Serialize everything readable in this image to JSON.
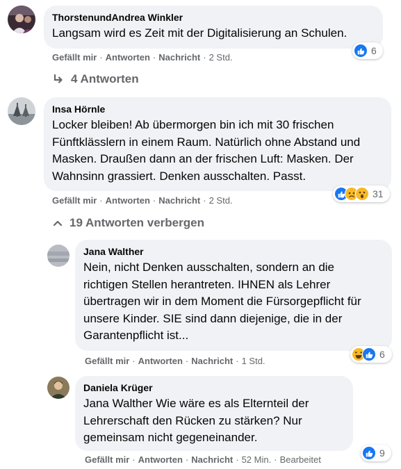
{
  "common": {
    "like": "Gefällt mir",
    "reply": "Antworten",
    "message": "Nachricht",
    "dot": "·"
  },
  "comments": [
    {
      "author": "ThorstenundAndrea Winkler",
      "text": "Langsam wird es Zeit mit der Digitalisierung an Schulen.",
      "time": "2 Std.",
      "reaction_count": "6",
      "reactions": [
        "like-icon"
      ]
    },
    {
      "author": "Insa Hörnle",
      "text": "Locker bleiben! Ab übermorgen bin ich mit 30 frischen Fünftklässlern in einem Raum. Natürlich ohne Abstand und Masken. Draußen dann an der frischen Luft: Masken. Der Wahnsinn grassiert. Denken ausschalten. Passt.",
      "time": "2 Std.",
      "reaction_count": "31",
      "reactions": [
        "like-icon",
        "sad-icon",
        "wow-icon"
      ]
    }
  ],
  "replies_toggle_1": "4 Antworten",
  "replies_toggle_2": "19 Antworten verbergen",
  "replies": [
    {
      "author": "Jana Walther",
      "text": "Nein, nicht Denken ausschalten, sondern an die richtigen Stellen herantreten. IHNEN als Lehrer übertragen wir in dem Moment die Fürsorgepflicht für unsere Kinder. SIE sind dann diejenige, die in der Garantenpflicht ist...",
      "time": "1 Std.",
      "reaction_count": "6",
      "reactions": [
        "haha-icon",
        "like-icon"
      ]
    },
    {
      "author": "Daniela Krüger",
      "text": "Jana Walther Wie wäre es als Elternteil der Lehrerschaft den Rücken zu stärken? Nur gemeinsam nicht gegeneinander.",
      "time": "52 Min.",
      "edited": "Bearbeitet",
      "reaction_count": "9",
      "reactions": [
        "like-icon"
      ]
    }
  ],
  "colors": {
    "bubble": "#f0f2f5",
    "meta": "#65676b",
    "like": "#1877f2",
    "emoji": "#f7b928"
  }
}
